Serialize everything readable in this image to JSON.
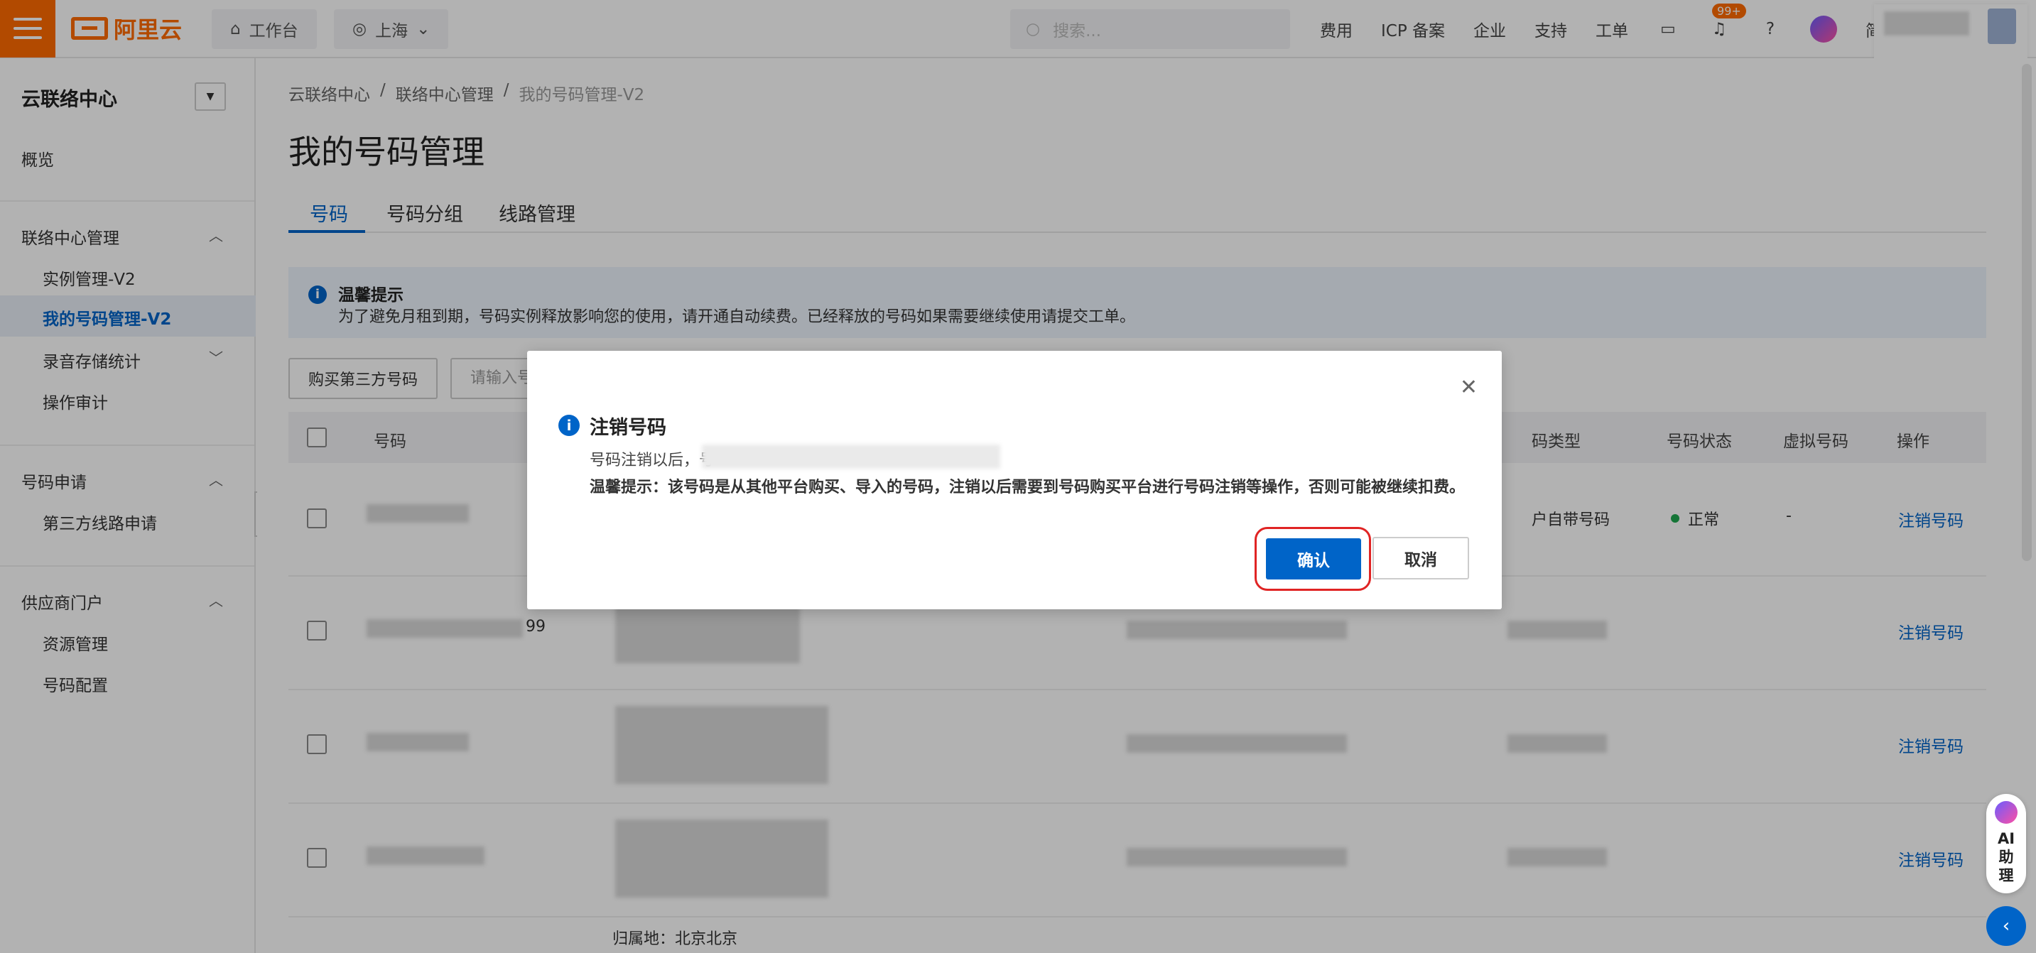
{
  "header": {
    "logo_text": "阿里云",
    "workbench": "工作台",
    "region": "上海",
    "search_placeholder": "搜索...",
    "nav": [
      "费用",
      "ICP 备案",
      "企业",
      "支持",
      "工单"
    ],
    "notification_count": "99+",
    "lang": "简体"
  },
  "sidebar": {
    "title": "云联络中心",
    "overview": "概览",
    "group1": "联络中心管理",
    "g1_items": [
      "实例管理-V2",
      "我的号码管理-V2",
      "录音存储统计",
      "操作审计"
    ],
    "group2": "号码申请",
    "g2_items": [
      "第三方线路申请"
    ],
    "group3": "供应商门户",
    "g3_items": [
      "资源管理",
      "号码配置"
    ]
  },
  "breadcrumb": [
    "云联络中心",
    "联络中心管理",
    "我的号码管理-V2"
  ],
  "page": {
    "title": "我的号码管理",
    "tabs": [
      "号码",
      "号码分组",
      "线路管理"
    ],
    "notice_title": "温馨提示",
    "notice_text": "为了避免月租到期，号码实例释放影响您的使用，请开通自动续费。已经释放的号码如果需要继续使用请提交工单。",
    "buy_button": "购买第三方号码",
    "input_placeholder": "请输入号",
    "table_headers": [
      "号码",
      "码类型",
      "号码状态",
      "虚拟号码",
      "操作"
    ],
    "row1": {
      "type": "户自带号码",
      "status": "正常",
      "virtual": "-",
      "action": "注销号码"
    },
    "row2": {
      "number_suffix": "99",
      "action": "注销号码"
    },
    "row3": {
      "action": "注销号码"
    },
    "row4": {
      "action": "注销号码"
    },
    "footer_text": "归属地：北京北京"
  },
  "modal": {
    "title": "注销号码",
    "line1": "号码注销以后，号",
    "line2": "温馨提示：该号码是从其他平台购买、导入的号码，注销以后需要到号码购买平台进行号码注销等操作，否则可能被继续扣费。",
    "confirm": "确认",
    "cancel": "取消"
  },
  "ai_assistant": "AI助理"
}
